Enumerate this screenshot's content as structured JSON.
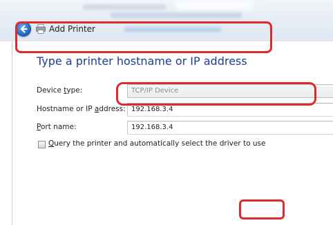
{
  "window": {
    "title": "Add Printer"
  },
  "page": {
    "heading": "Type a printer hostname or IP address"
  },
  "form": {
    "device_type_label_pre": "Device ",
    "device_type_label_acc": "t",
    "device_type_label_post": "ype:",
    "device_type_value": "TCP/IP Device",
    "hostname_label_pre": "Hostname or IP ",
    "hostname_label_acc": "a",
    "hostname_label_post": "ddress:",
    "hostname_value": "192.168.3.4",
    "port_label_acc": "P",
    "port_label_post": "ort name:",
    "port_value": "192.168.3.4",
    "query_checkbox_label_acc": "Q",
    "query_checkbox_label_post": "uery the printer and automatically select the driver to use",
    "query_checkbox_checked": false
  },
  "icons": {
    "back": "back-arrow-icon",
    "printer": "printer-icon"
  },
  "colors": {
    "heading": "#1f3d8f",
    "annotation": "#e02a2a",
    "back_button": "#2a6fc9"
  }
}
